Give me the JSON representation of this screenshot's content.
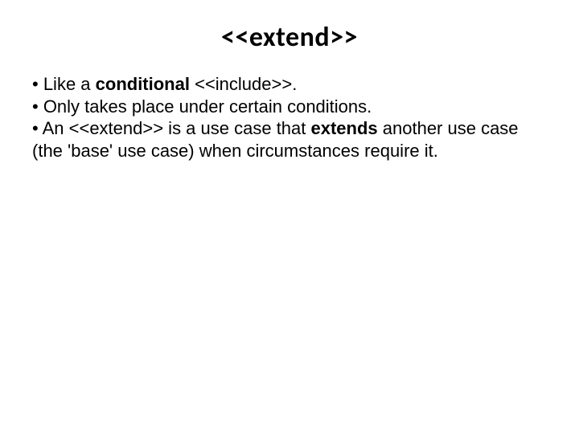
{
  "title": "<<extend>>",
  "bullets": {
    "b1_prefix": "• Like a ",
    "b1_bold": "conditional ",
    "b1_suffix": "<<include>>.",
    "b2": "• Only takes place under certain conditions.",
    "b3_prefix": "• An <<extend>> is a use case that ",
    "b3_bold": "extends ",
    "b3_suffix": "another use case (the 'base' use case) when circumstances require it."
  }
}
